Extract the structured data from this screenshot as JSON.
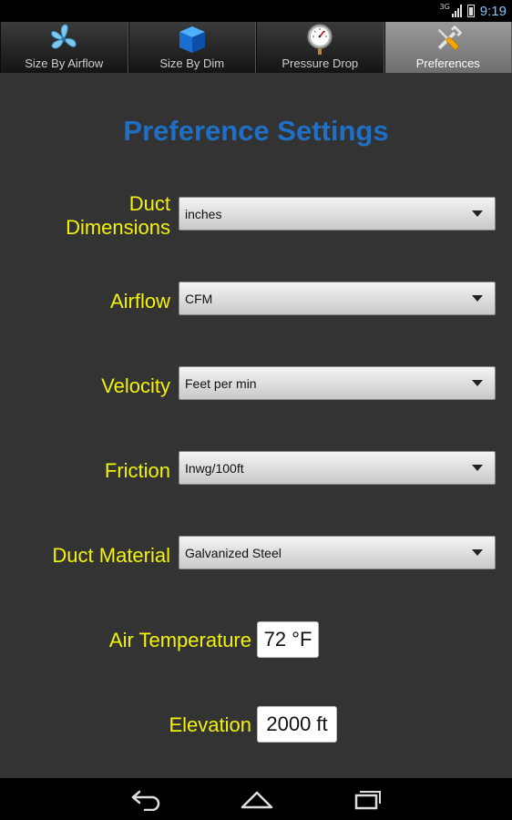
{
  "status_bar": {
    "network": "3G",
    "time": "9:19"
  },
  "tabs": [
    {
      "label": "Size By Airflow",
      "icon": "fan-icon"
    },
    {
      "label": "Size By Dim",
      "icon": "cube-icon"
    },
    {
      "label": "Pressure Drop",
      "icon": "pressure-gauge-icon"
    },
    {
      "label": "Preferences",
      "icon": "tools-icon",
      "active": true
    }
  ],
  "title": "Preference Settings",
  "settings": {
    "duct_dimensions": {
      "label_line1": "Duct",
      "label_line2": "Dimensions",
      "value": "inches"
    },
    "airflow": {
      "label": "Airflow",
      "value": "CFM"
    },
    "velocity": {
      "label": "Velocity",
      "value": "Feet per min"
    },
    "friction": {
      "label": "Friction",
      "value": "Inwg/100ft"
    },
    "duct_material": {
      "label": "Duct Material",
      "value": "Galvanized Steel"
    },
    "air_temperature": {
      "label": "Air Temperature",
      "value": "72 °F"
    },
    "elevation": {
      "label": "Elevation",
      "value": "2000 ft"
    }
  },
  "colors": {
    "title": "#1f6fc4",
    "label": "#f2f20a",
    "background": "#333333",
    "clock": "#7fc6ff"
  },
  "nav": {
    "back": "back-icon",
    "home": "home-icon",
    "recents": "recent-apps-icon"
  }
}
